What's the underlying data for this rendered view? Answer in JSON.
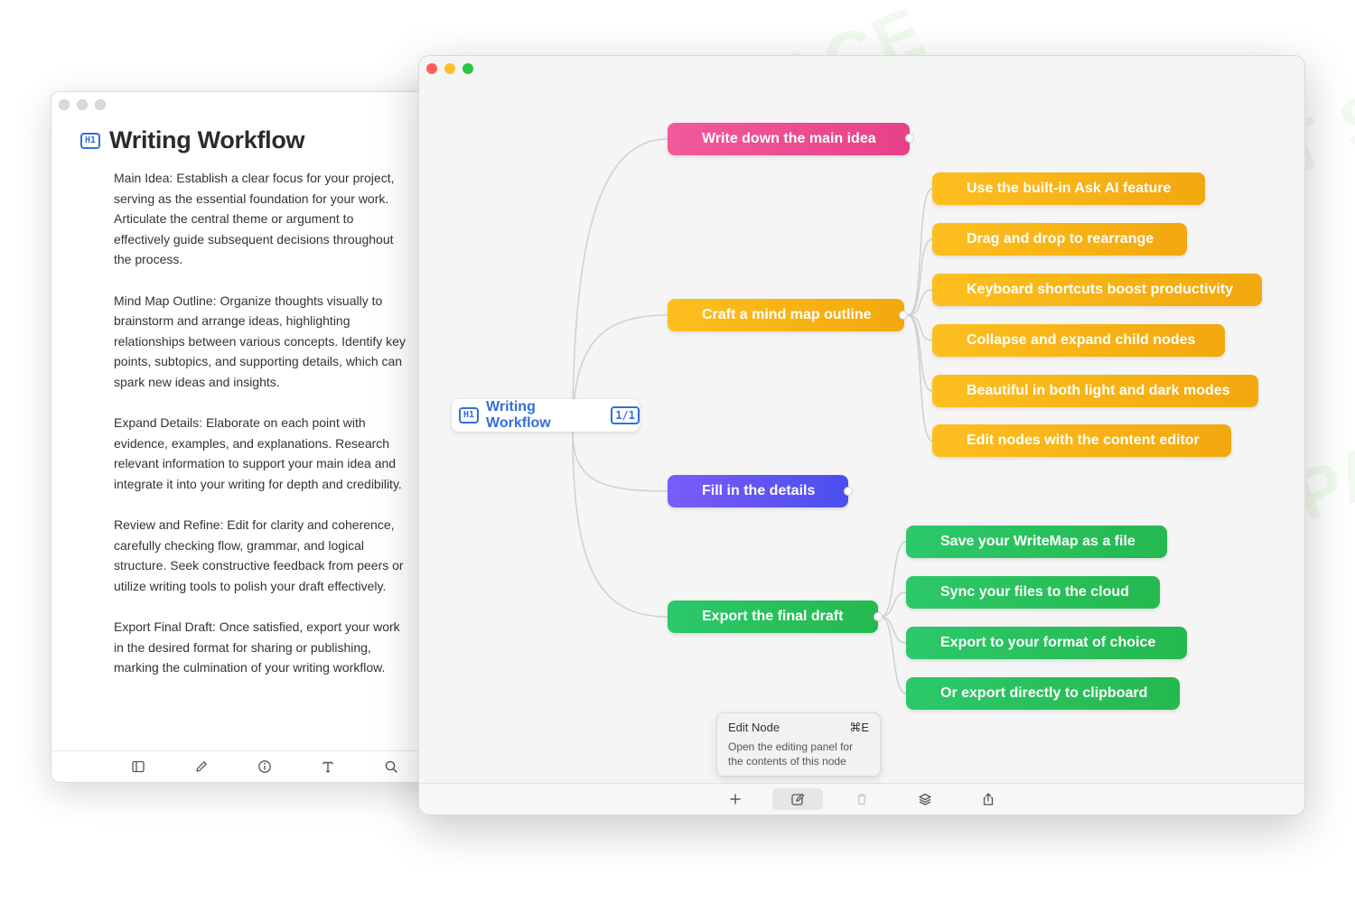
{
  "editor": {
    "heading_badge": "H1",
    "title": "Writing Workflow",
    "paragraphs": [
      "Main Idea: Establish a clear focus for your project, serving as the essential foundation for your work. Articulate the central theme or argument to effectively guide subsequent decisions throughout the process.",
      "Mind Map Outline: Organize thoughts visually to brainstorm and arrange ideas, highlighting relationships between various concepts. Identify key points, subtopics, and supporting details, which can spark new ideas and insights.",
      "Expand Details: Elaborate on each point with evidence, examples, and explanations. Research relevant information to support your main idea and integrate it into your writing for depth and credibility.",
      "Review and Refine: Edit for clarity and coherence, carefully checking flow, grammar, and logical structure. Seek constructive feedback from peers or utilize writing tools to polish your draft effectively.",
      "Export Final Draft: Once satisfied, export your work in the desired format for sharing or publishing, marking the culmination of your writing workflow."
    ],
    "toolbar": [
      "sidebar-icon",
      "pencil-icon",
      "info-icon",
      "text-icon",
      "search-icon"
    ]
  },
  "mindmap": {
    "root": {
      "badge": "H1",
      "title": "Writing Workflow",
      "count": "1/1"
    },
    "branches": [
      {
        "label": "Write down the main idea",
        "color": "#ee4f92",
        "children": []
      },
      {
        "label": "Craft a mind map outline",
        "color": "#f7b316",
        "children": [
          "Use the built-in Ask AI feature",
          "Drag and drop to rearrange",
          "Keyboard shortcuts boost productivity",
          "Collapse and expand child nodes",
          "Beautiful in both light and dark modes",
          "Edit nodes with the content editor"
        ]
      },
      {
        "label": "Fill in the details",
        "color": "#5e55f3",
        "children": []
      },
      {
        "label": "Export the final draft",
        "color": "#28c05c",
        "children": [
          "Save your WriteMap as a file",
          "Sync your files to the cloud",
          "Export to your format of choice",
          "Or export directly to clipboard"
        ]
      }
    ],
    "tooltip": {
      "title": "Edit Node",
      "shortcut": "⌘E",
      "description": "Open the editing panel for the contents of this node"
    },
    "toolbar": [
      "add-icon",
      "edit-icon",
      "trash-icon",
      "layers-icon",
      "share-icon"
    ]
  }
}
